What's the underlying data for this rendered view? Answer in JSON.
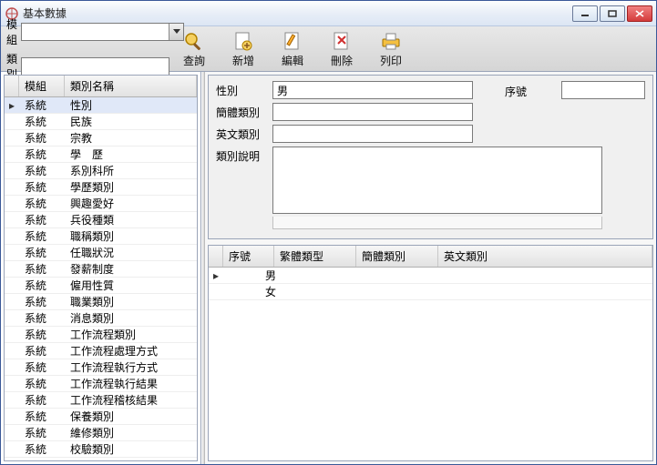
{
  "window": {
    "title": "基本數據"
  },
  "filters": {
    "module_label": "模組",
    "category_label": "類別",
    "module_value": "",
    "category_value": ""
  },
  "toolbar": {
    "query": "查詢",
    "add": "新增",
    "edit": "編輯",
    "delete": "刪除",
    "print": "列印"
  },
  "left_grid": {
    "headers": {
      "module": "模組",
      "name": "類別名稱"
    },
    "rows": [
      {
        "module": "系統",
        "name": "性別",
        "selected": true
      },
      {
        "module": "系統",
        "name": "民族"
      },
      {
        "module": "系統",
        "name": "宗教"
      },
      {
        "module": "系統",
        "name": "學　歷"
      },
      {
        "module": "系統",
        "name": "系別科所"
      },
      {
        "module": "系統",
        "name": "學歷類別"
      },
      {
        "module": "系統",
        "name": "興趣愛好"
      },
      {
        "module": "系統",
        "name": "兵役種類"
      },
      {
        "module": "系統",
        "name": "職稱類別"
      },
      {
        "module": "系統",
        "name": "任職狀況"
      },
      {
        "module": "系統",
        "name": "發薪制度"
      },
      {
        "module": "系統",
        "name": "僱用性質"
      },
      {
        "module": "系統",
        "name": "職業類別"
      },
      {
        "module": "系統",
        "name": "消息類別"
      },
      {
        "module": "系統",
        "name": "工作流程類別"
      },
      {
        "module": "系統",
        "name": "工作流程處理方式"
      },
      {
        "module": "系統",
        "name": "工作流程執行方式"
      },
      {
        "module": "系統",
        "name": "工作流程執行結果"
      },
      {
        "module": "系統",
        "name": "工作流程稽核結果"
      },
      {
        "module": "系統",
        "name": "保養類別"
      },
      {
        "module": "系統",
        "name": "維修類別"
      },
      {
        "module": "系統",
        "name": "校驗類別"
      }
    ]
  },
  "form": {
    "labels": {
      "gender": "性別",
      "simp": "簡體類別",
      "eng": "英文類別",
      "desc": "類別說明",
      "seq": "序號"
    },
    "values": {
      "gender": "男",
      "simp": "",
      "eng": "",
      "desc": "",
      "seq": ""
    }
  },
  "right_grid": {
    "headers": {
      "seq": "序號",
      "trad": "繁體類型",
      "simp": "簡體類別",
      "eng": "英文類別"
    },
    "rows": [
      {
        "seq": "",
        "trad": "男",
        "simp": "",
        "eng": "",
        "current": true
      },
      {
        "seq": "",
        "trad": "女",
        "simp": "",
        "eng": ""
      }
    ]
  }
}
